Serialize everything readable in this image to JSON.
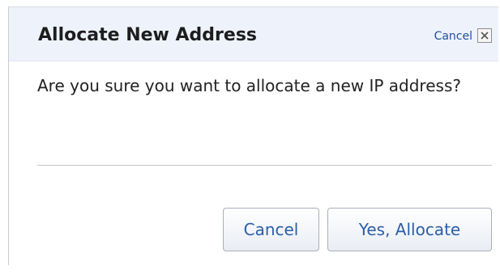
{
  "dialog": {
    "title": "Allocate New Address",
    "header_cancel_label": "Cancel",
    "message": "Are you sure you want to allocate a new IP address?",
    "buttons": {
      "cancel_label": "Cancel",
      "confirm_label": "Yes, Allocate"
    },
    "colors": {
      "header_bg": "#eef3fb",
      "link": "#1f4f9f",
      "button_text": "#2b5ea8"
    },
    "icons": {
      "close": "close-icon"
    }
  }
}
